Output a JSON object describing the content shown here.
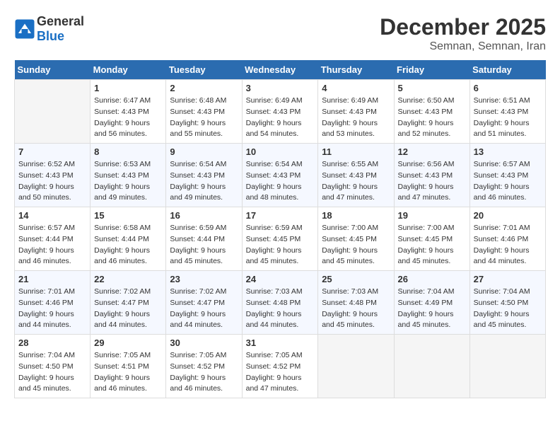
{
  "header": {
    "logo_general": "General",
    "logo_blue": "Blue",
    "month": "December 2025",
    "location": "Semnan, Semnan, Iran"
  },
  "weekdays": [
    "Sunday",
    "Monday",
    "Tuesday",
    "Wednesday",
    "Thursday",
    "Friday",
    "Saturday"
  ],
  "weeks": [
    [
      {
        "day": "",
        "empty": true
      },
      {
        "day": "1",
        "sunrise": "6:47 AM",
        "sunset": "4:43 PM",
        "daylight": "9 hours and 56 minutes."
      },
      {
        "day": "2",
        "sunrise": "6:48 AM",
        "sunset": "4:43 PM",
        "daylight": "9 hours and 55 minutes."
      },
      {
        "day": "3",
        "sunrise": "6:49 AM",
        "sunset": "4:43 PM",
        "daylight": "9 hours and 54 minutes."
      },
      {
        "day": "4",
        "sunrise": "6:49 AM",
        "sunset": "4:43 PM",
        "daylight": "9 hours and 53 minutes."
      },
      {
        "day": "5",
        "sunrise": "6:50 AM",
        "sunset": "4:43 PM",
        "daylight": "9 hours and 52 minutes."
      },
      {
        "day": "6",
        "sunrise": "6:51 AM",
        "sunset": "4:43 PM",
        "daylight": "9 hours and 51 minutes."
      }
    ],
    [
      {
        "day": "7",
        "sunrise": "6:52 AM",
        "sunset": "4:43 PM",
        "daylight": "9 hours and 50 minutes."
      },
      {
        "day": "8",
        "sunrise": "6:53 AM",
        "sunset": "4:43 PM",
        "daylight": "9 hours and 49 minutes."
      },
      {
        "day": "9",
        "sunrise": "6:54 AM",
        "sunset": "4:43 PM",
        "daylight": "9 hours and 49 minutes."
      },
      {
        "day": "10",
        "sunrise": "6:54 AM",
        "sunset": "4:43 PM",
        "daylight": "9 hours and 48 minutes."
      },
      {
        "day": "11",
        "sunrise": "6:55 AM",
        "sunset": "4:43 PM",
        "daylight": "9 hours and 47 minutes."
      },
      {
        "day": "12",
        "sunrise": "6:56 AM",
        "sunset": "4:43 PM",
        "daylight": "9 hours and 47 minutes."
      },
      {
        "day": "13",
        "sunrise": "6:57 AM",
        "sunset": "4:43 PM",
        "daylight": "9 hours and 46 minutes."
      }
    ],
    [
      {
        "day": "14",
        "sunrise": "6:57 AM",
        "sunset": "4:44 PM",
        "daylight": "9 hours and 46 minutes."
      },
      {
        "day": "15",
        "sunrise": "6:58 AM",
        "sunset": "4:44 PM",
        "daylight": "9 hours and 46 minutes."
      },
      {
        "day": "16",
        "sunrise": "6:59 AM",
        "sunset": "4:44 PM",
        "daylight": "9 hours and 45 minutes."
      },
      {
        "day": "17",
        "sunrise": "6:59 AM",
        "sunset": "4:45 PM",
        "daylight": "9 hours and 45 minutes."
      },
      {
        "day": "18",
        "sunrise": "7:00 AM",
        "sunset": "4:45 PM",
        "daylight": "9 hours and 45 minutes."
      },
      {
        "day": "19",
        "sunrise": "7:00 AM",
        "sunset": "4:45 PM",
        "daylight": "9 hours and 45 minutes."
      },
      {
        "day": "20",
        "sunrise": "7:01 AM",
        "sunset": "4:46 PM",
        "daylight": "9 hours and 44 minutes."
      }
    ],
    [
      {
        "day": "21",
        "sunrise": "7:01 AM",
        "sunset": "4:46 PM",
        "daylight": "9 hours and 44 minutes."
      },
      {
        "day": "22",
        "sunrise": "7:02 AM",
        "sunset": "4:47 PM",
        "daylight": "9 hours and 44 minutes."
      },
      {
        "day": "23",
        "sunrise": "7:02 AM",
        "sunset": "4:47 PM",
        "daylight": "9 hours and 44 minutes."
      },
      {
        "day": "24",
        "sunrise": "7:03 AM",
        "sunset": "4:48 PM",
        "daylight": "9 hours and 44 minutes."
      },
      {
        "day": "25",
        "sunrise": "7:03 AM",
        "sunset": "4:48 PM",
        "daylight": "9 hours and 45 minutes."
      },
      {
        "day": "26",
        "sunrise": "7:04 AM",
        "sunset": "4:49 PM",
        "daylight": "9 hours and 45 minutes."
      },
      {
        "day": "27",
        "sunrise": "7:04 AM",
        "sunset": "4:50 PM",
        "daylight": "9 hours and 45 minutes."
      }
    ],
    [
      {
        "day": "28",
        "sunrise": "7:04 AM",
        "sunset": "4:50 PM",
        "daylight": "9 hours and 45 minutes."
      },
      {
        "day": "29",
        "sunrise": "7:05 AM",
        "sunset": "4:51 PM",
        "daylight": "9 hours and 46 minutes."
      },
      {
        "day": "30",
        "sunrise": "7:05 AM",
        "sunset": "4:52 PM",
        "daylight": "9 hours and 46 minutes."
      },
      {
        "day": "31",
        "sunrise": "7:05 AM",
        "sunset": "4:52 PM",
        "daylight": "9 hours and 47 minutes."
      },
      {
        "day": "",
        "empty": true
      },
      {
        "day": "",
        "empty": true
      },
      {
        "day": "",
        "empty": true
      }
    ]
  ]
}
